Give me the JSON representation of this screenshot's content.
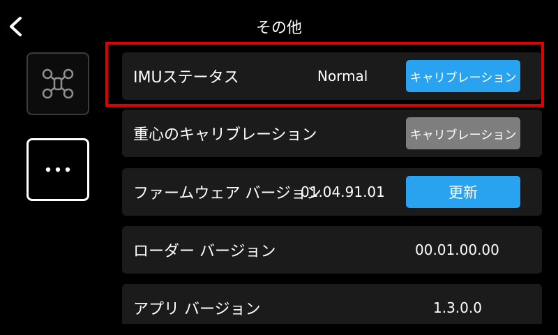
{
  "header": {
    "title": "その他"
  },
  "rows": [
    {
      "label": "IMUステータス",
      "value": "Normal",
      "button": "キャリブレーション"
    },
    {
      "label": "重心のキャリブレーション",
      "button": "キャリブレーション"
    },
    {
      "label": "ファームウェア バージョン",
      "value": "01.04.91.01",
      "button": "更新"
    },
    {
      "label": "ローダー バージョン",
      "value": "00.01.00.00"
    },
    {
      "label": "アプリ バージョン",
      "value": "1.3.0.0"
    }
  ],
  "colors": {
    "accent": "#29a3f0",
    "disabled": "#7e7e7e",
    "row_bg": "#1b1b1b",
    "highlight": "#e00000"
  },
  "icons": {
    "back": "chevron-left-icon",
    "drone": "drone-icon",
    "more": "more-dots-icon"
  }
}
